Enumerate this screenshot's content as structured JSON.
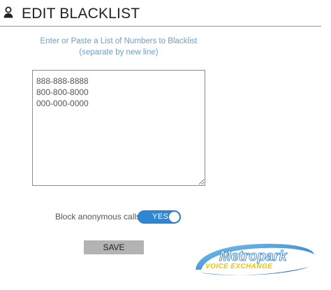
{
  "header": {
    "title": "EDIT BLACKLIST",
    "icon": "user-icon"
  },
  "instructions": {
    "line1": "Enter or Paste a List of Numbers to Blacklist",
    "line2": "(separate by new line)"
  },
  "blacklist": {
    "value": "888-888-8888\n800-800-8000\n000-000-0000"
  },
  "anonymous": {
    "label": "Block anonymous calls:",
    "toggle_text": "YES",
    "enabled": true
  },
  "save": {
    "label": "SAVE"
  },
  "logo": {
    "line1": "Metropark",
    "line2": "VOICE EXCHANGE"
  },
  "colors": {
    "accent_blue": "#2f86d4",
    "instruction_text": "#6f9dc9",
    "header_rule": "#5aa9b8",
    "button_gray": "#b3b3b3",
    "logo_yellow": "#f2c300"
  }
}
